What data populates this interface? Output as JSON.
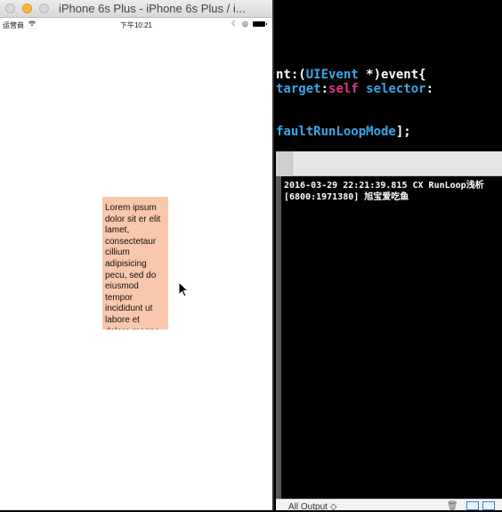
{
  "simulator": {
    "window_title": "iPhone 6s Plus - iPhone 6s Plus / i...",
    "status": {
      "carrier": "运营商",
      "time": "下午10:21"
    },
    "text_box": "Lorem ipsum dolor sit er elit lamet, consectetaur cillium adipisicing pecu, sed do eiusmod tempor incididunt ut labore et dolore magna"
  },
  "editor": {
    "line1": {
      "a": "nt:(",
      "b": "UIEvent",
      "c": " *)event{"
    },
    "line2": {
      "a": "target",
      "b": ":",
      "c": "self",
      "d": " selector",
      "e": ":"
    },
    "line3": {
      "a": "faultRunLoopMode",
      "b": "];"
    }
  },
  "console": {
    "output": "2016-03-29 22:21:39.815 CX RunLoop浅析[6800:1971380] 旭宝爱吃鱼",
    "filter_label": "All Output ◇"
  },
  "colors": {
    "text_box_bg": "#f9c7ad",
    "keyword_blue": "#3aa6e8",
    "keyword_pink": "#e2368f"
  }
}
